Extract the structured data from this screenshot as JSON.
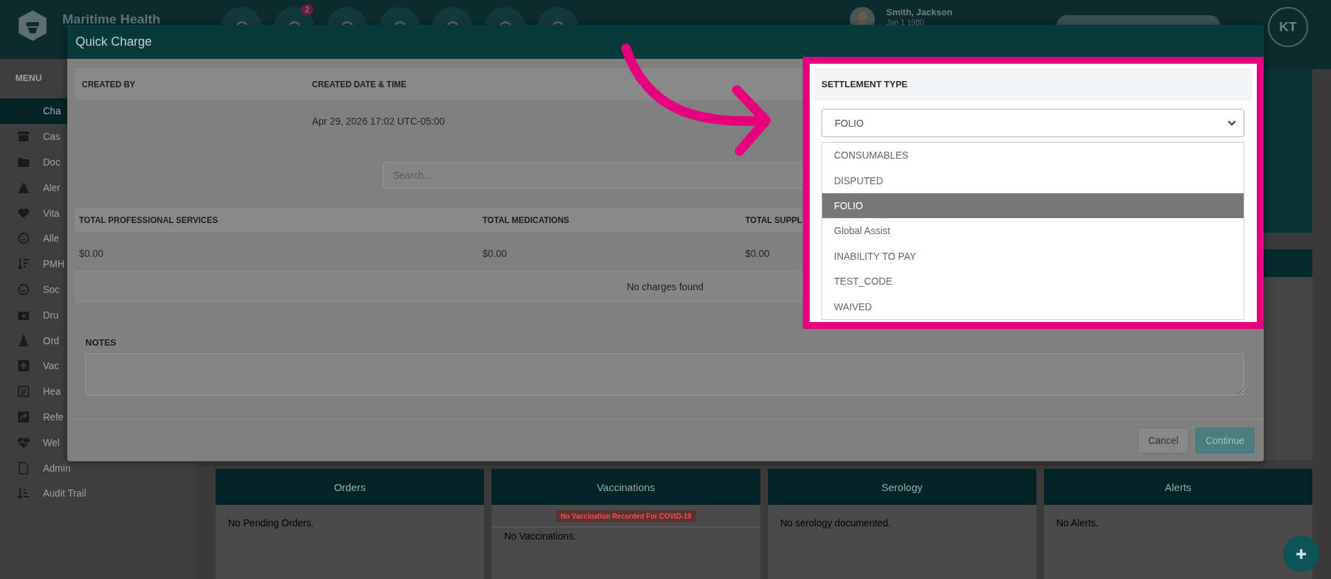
{
  "app_bar": {
    "title": "Maritime Health",
    "notification_count": "2",
    "patient": {
      "name": "Smith, Jackson",
      "dob": "Jan 1 1980"
    },
    "user_initials": "KT"
  },
  "sidebar": {
    "heading": "MENU",
    "items": [
      {
        "label": "Cha",
        "selected": true
      },
      {
        "label": "Cas",
        "selected": false
      },
      {
        "label": "Doc",
        "selected": false
      },
      {
        "label": "Aler",
        "selected": false
      },
      {
        "label": "Vita",
        "selected": false
      },
      {
        "label": "Alle",
        "selected": false
      },
      {
        "label": "PMH",
        "selected": false
      },
      {
        "label": "Soc",
        "selected": false
      },
      {
        "label": "Dru",
        "selected": false
      },
      {
        "label": "Ord",
        "selected": false
      },
      {
        "label": "Vac",
        "selected": false
      },
      {
        "label": "Hea",
        "selected": false
      },
      {
        "label": "Refe",
        "selected": false
      },
      {
        "label": "Wel",
        "selected": false
      },
      {
        "label": "Admin",
        "selected": false
      },
      {
        "label": "Audit Trail",
        "selected": false
      }
    ]
  },
  "cards": [
    {
      "title": "Orders",
      "message": "No Pending Orders."
    },
    {
      "title": "Vaccinations",
      "notice": "No Vaccination Recorded For COVID-19",
      "message": "No Vaccinations."
    },
    {
      "title": "Serology",
      "message": "No serology documented."
    },
    {
      "title": "Alerts",
      "message": "No Alerts."
    }
  ],
  "modal": {
    "title": "Quick Charge",
    "created_by_label": "CREATED BY",
    "created_date_label": "CREATED DATE & TIME",
    "created_date_value": "Apr 29, 2026 17:02 UTC-05:00",
    "search": {
      "placeholder": "Search..."
    },
    "totals": [
      {
        "label": "TOTAL PROFESSIONAL SERVICES",
        "value": "$0.00"
      },
      {
        "label": "TOTAL MEDICATIONS",
        "value": "$0.00"
      },
      {
        "label": "TOTAL SUPPL",
        "value": "$0.00"
      }
    ],
    "empty_message": "No charges found",
    "notes": {
      "label": "NOTES"
    },
    "buttons": [
      {
        "label": "Cancel",
        "kind": "secondary"
      },
      {
        "label": "Continue",
        "kind": "primary"
      }
    ],
    "settlement": {
      "label": "SETTLEMENT TYPE",
      "value": "FOLIO",
      "expanded": true,
      "options": [
        {
          "label": "CONSUMABLES",
          "selected": false
        },
        {
          "label": "DISPUTED",
          "selected": false
        },
        {
          "label": "FOLIO",
          "selected": true
        },
        {
          "label": "Global Assist",
          "selected": false
        },
        {
          "label": "INABILITY TO PAY",
          "selected": false
        },
        {
          "label": "TEST_CODE",
          "selected": false
        },
        {
          "label": "WAIVED",
          "selected": false
        }
      ]
    }
  }
}
